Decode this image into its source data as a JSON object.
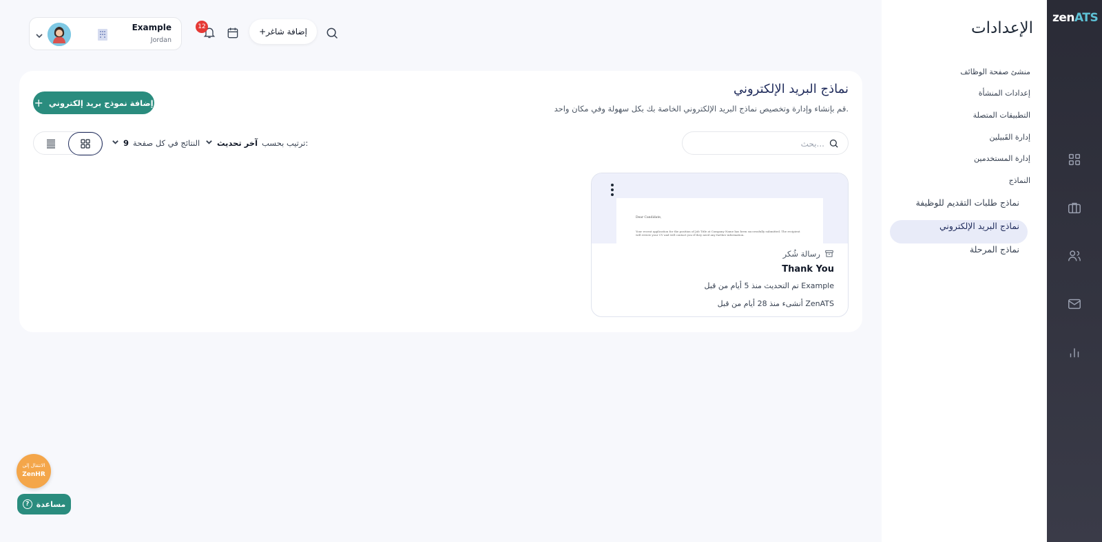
{
  "brand": {
    "logo_zen": "zen",
    "logo_ats": "ATS"
  },
  "rail": {
    "icons": [
      "grid-icon",
      "briefcase-icon",
      "users-icon",
      "mail-icon",
      "bar-chart-icon"
    ]
  },
  "settings": {
    "title": "الإعدادات",
    "nav": [
      "منشئ صفحة الوظائف",
      "إعدادات المنشأة",
      "التطبيقات المتصلة",
      "إدارة القَبيلين",
      "إدارة المستخدمين",
      "النماذج"
    ],
    "sub": [
      "نماذج طلبات التقديم للوظيفة",
      "نماذج البريد الإلكتروني",
      "نماذج المرحلة"
    ],
    "active_sub": "نماذج البريد الإلكتروني"
  },
  "header": {
    "add_poet_label": "+إضافة شاغر",
    "notification_count": "12",
    "account_name": "Example",
    "account_country": "Jordan"
  },
  "page": {
    "title": "نماذج البريد الإلكتروني",
    "description": "قم بإنشاء وإدارة وتخصيص نماذج البريد الإلكتروني الخاصة بك بكل سهولة وفي مكان واحد.",
    "add_button_label": "إضافة نموذج بريد إلكتروني",
    "search_placeholder": "بحث...",
    "per_page_label": "النتائج في كل صفحة",
    "per_page_value": "9",
    "sort_label": "ترتيب بحسب:",
    "sort_value": "آخر تحديث"
  },
  "templates": [
    {
      "category": "رسالة شُكر",
      "title": "Thank You",
      "updated": "تم التحديث منذ 5 أيام من قبل Example",
      "created": "أنشىء منذ 28 أيام من قبل ZenATS",
      "preview_greeting": "Dear Candidate,",
      "preview_body": "Your recent application for the position of Job Title at Company Name has been successfully submitted. The recipient will review your CV and will contact you if they need any further information."
    }
  ],
  "floating": {
    "zenhr_line1": "الانتقال إلى",
    "zenhr_line2": "ZenHR",
    "help_label": "مساعدة"
  }
}
